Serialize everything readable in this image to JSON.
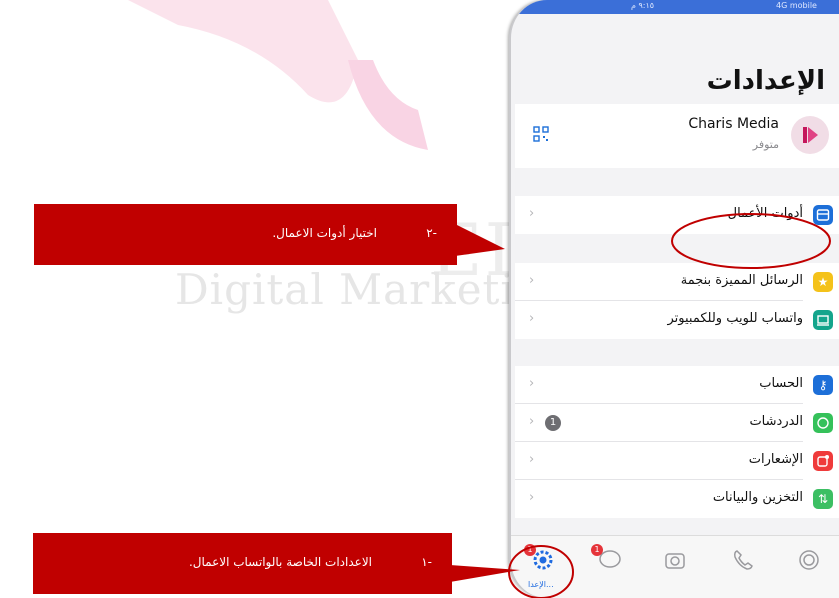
{
  "statusbar": {
    "time": "٩:١٥ م",
    "network": "4G mobile"
  },
  "settings": {
    "title": "الإعدادات",
    "profile": {
      "name": "Charis Media",
      "status": "متوفر"
    },
    "rows": [
      {
        "label": "أدوات الأعمال",
        "icon": "business-tools-icon",
        "color": "#1d6fd8"
      },
      {
        "label": "الرسائل المميزة بنجمة",
        "icon": "star-icon",
        "color": "#f4c21a"
      },
      {
        "label": "واتساب للويب وللكمبيوتر",
        "icon": "laptop-icon",
        "color": "#14a58c"
      },
      {
        "label": "الحساب",
        "icon": "key-icon",
        "color": "#1d6fd8"
      },
      {
        "label": "الدردشات",
        "icon": "chat-bubble-icon",
        "color": "#35c15a",
        "badge": "1"
      },
      {
        "label": "الإشعارات",
        "icon": "notification-icon",
        "color": "#ef3b3b"
      },
      {
        "label": "التخزين والبيانات",
        "icon": "storage-icon",
        "color": "#3cbf63"
      }
    ]
  },
  "tabbar": {
    "active_label": "الإعدا...",
    "settings_badge": "1",
    "chats_badge": "1"
  },
  "callouts": {
    "step2": {
      "number": "-٢",
      "text": "اختيار أدوات الاعمال."
    },
    "step1": {
      "number": "-١",
      "text": "الاعدادات الخاصة بالواتساب الاعمال."
    }
  },
  "colors": {
    "callout": "#c00000",
    "highlight": "#c00000",
    "accent": "#1f6be0"
  }
}
